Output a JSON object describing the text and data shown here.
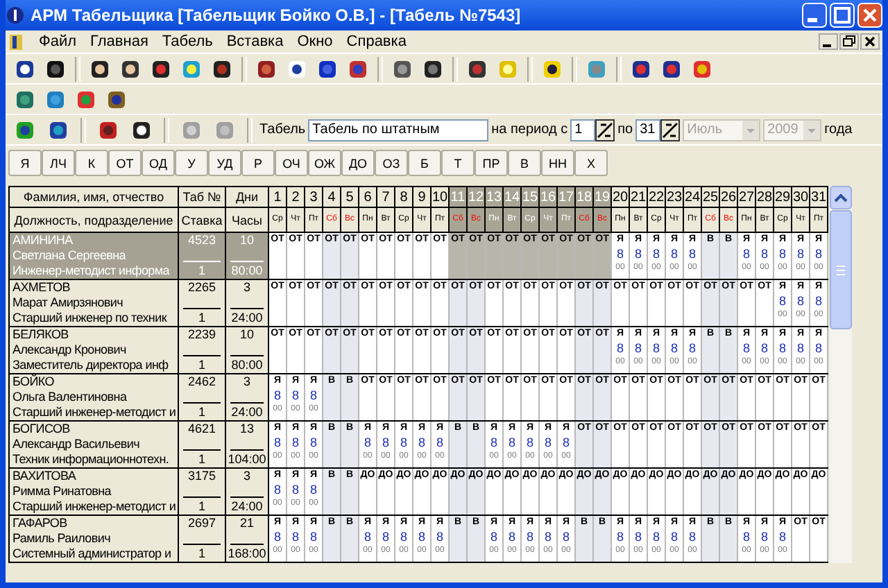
{
  "window": {
    "title": "АРМ Табельщика [Табельщик Бойко О.В.] - [Табель №7543]"
  },
  "menu": [
    "Файл",
    "Главная",
    "Табель",
    "Вставка",
    "Окно",
    "Справка"
  ],
  "form": {
    "label": "Табель",
    "value": "Табель по штатным",
    "period_label": "на период с",
    "from": "1",
    "to_label": "по",
    "to": "31",
    "month": {
      "value": "Июль",
      "disabled": true
    },
    "year": {
      "value": "2009",
      "disabled": true
    },
    "year_label": "года"
  },
  "code_buttons": [
    "Я",
    "ЛЧ",
    "К",
    "ОТ",
    "ОД",
    "У",
    "УД",
    "Р",
    "ОЧ",
    "ОЖ",
    "ДО",
    "ОЗ",
    "Б",
    "Т",
    "ПР",
    "В",
    "НН",
    "Х"
  ],
  "table": {
    "headers": {
      "name": "Фамилия, имя, отчество",
      "position": "Должность, подразделение",
      "tab": "Таб №",
      "rate": "Ставка",
      "days": "Дни",
      "hours": "Часы"
    },
    "days": [
      {
        "number": "1",
        "weekday": "Ср",
        "weekend": false,
        "selected": false
      },
      {
        "number": "2",
        "weekday": "Чт",
        "weekend": false,
        "selected": false
      },
      {
        "number": "3",
        "weekday": "Пт",
        "weekend": false,
        "selected": false
      },
      {
        "number": "4",
        "weekday": "Сб",
        "weekend": true,
        "selected": false
      },
      {
        "number": "5",
        "weekday": "Вс",
        "weekend": true,
        "selected": false
      },
      {
        "number": "6",
        "weekday": "Пн",
        "weekend": false,
        "selected": false
      },
      {
        "number": "7",
        "weekday": "Вт",
        "weekend": false,
        "selected": false
      },
      {
        "number": "8",
        "weekday": "Ср",
        "weekend": false,
        "selected": false
      },
      {
        "number": "9",
        "weekday": "Чт",
        "weekend": false,
        "selected": false
      },
      {
        "number": "10",
        "weekday": "Пт",
        "weekend": false,
        "selected": false
      },
      {
        "number": "11",
        "weekday": "Сб",
        "weekend": true,
        "selected": true
      },
      {
        "number": "12",
        "weekday": "Вс",
        "weekend": true,
        "selected": true
      },
      {
        "number": "13",
        "weekday": "Пн",
        "weekend": false,
        "selected": true
      },
      {
        "number": "14",
        "weekday": "Вт",
        "weekend": false,
        "selected": true
      },
      {
        "number": "15",
        "weekday": "Ср",
        "weekend": false,
        "selected": true
      },
      {
        "number": "16",
        "weekday": "Чт",
        "weekend": false,
        "selected": true
      },
      {
        "number": "17",
        "weekday": "Пт",
        "weekend": false,
        "selected": true
      },
      {
        "number": "18",
        "weekday": "Сб",
        "weekend": true,
        "selected": true
      },
      {
        "number": "19",
        "weekday": "Вс",
        "weekend": true,
        "selected": true
      },
      {
        "number": "20",
        "weekday": "Пн",
        "weekend": false,
        "selected": false
      },
      {
        "number": "21",
        "weekday": "Вт",
        "weekend": false,
        "selected": false
      },
      {
        "number": "22",
        "weekday": "Ср",
        "weekend": false,
        "selected": false
      },
      {
        "number": "23",
        "weekday": "Чт",
        "weekend": false,
        "selected": false
      },
      {
        "number": "24",
        "weekday": "Пт",
        "weekend": false,
        "selected": false
      },
      {
        "number": "25",
        "weekday": "Сб",
        "weekend": true,
        "selected": false
      },
      {
        "number": "26",
        "weekday": "Вс",
        "weekend": true,
        "selected": false
      },
      {
        "number": "27",
        "weekday": "Пн",
        "weekend": false,
        "selected": false
      },
      {
        "number": "28",
        "weekday": "Вт",
        "weekend": false,
        "selected": false
      },
      {
        "number": "29",
        "weekday": "Ср",
        "weekend": false,
        "selected": false
      },
      {
        "number": "30",
        "weekday": "Чт",
        "weekend": false,
        "selected": false
      },
      {
        "number": "31",
        "weekday": "Пт",
        "weekend": false,
        "selected": false
      }
    ],
    "rows": [
      {
        "surname": "АМИНИНА",
        "name": "Светлана Сергеевна",
        "position": "Инженер-методист информа",
        "tab": "4523",
        "rate": "1",
        "days": "10",
        "hours": "80:00",
        "selected": true,
        "cells": [
          {
            "code": "ОТ"
          },
          {
            "code": "ОТ"
          },
          {
            "code": "ОТ"
          },
          {
            "code": "ОТ"
          },
          {
            "code": "ОТ"
          },
          {
            "code": "ОТ"
          },
          {
            "code": "ОТ"
          },
          {
            "code": "ОТ"
          },
          {
            "code": "ОТ"
          },
          {
            "code": "ОТ"
          },
          {
            "code": "ОТ"
          },
          {
            "code": "ОТ"
          },
          {
            "code": "ОТ"
          },
          {
            "code": "ОТ"
          },
          {
            "code": "ОТ"
          },
          {
            "code": "ОТ"
          },
          {
            "code": "ОТ"
          },
          {
            "code": "ОТ"
          },
          {
            "code": "ОТ"
          },
          {
            "code": "Я",
            "hours": "8",
            "minutes": "00"
          },
          {
            "code": "Я",
            "hours": "8",
            "minutes": "00"
          },
          {
            "code": "Я",
            "hours": "8",
            "minutes": "00"
          },
          {
            "code": "Я",
            "hours": "8",
            "minutes": "00"
          },
          {
            "code": "Я",
            "hours": "8",
            "minutes": "00"
          },
          {
            "code": "В"
          },
          {
            "code": "В"
          },
          {
            "code": "Я",
            "hours": "8",
            "minutes": "00"
          },
          {
            "code": "Я",
            "hours": "8",
            "minutes": "00"
          },
          {
            "code": "Я",
            "hours": "8",
            "minutes": "00"
          },
          {
            "code": "Я",
            "hours": "8",
            "minutes": "00"
          },
          {
            "code": "Я",
            "hours": "8",
            "minutes": "00"
          }
        ]
      },
      {
        "surname": "АХМЕТОВ",
        "name": "Марат Амирзянович",
        "position": "Старший инженер по техник",
        "tab": "2265",
        "rate": "1",
        "days": "3",
        "hours": "24:00",
        "selected": false,
        "cells": [
          {
            "code": "ОТ"
          },
          {
            "code": "ОТ"
          },
          {
            "code": "ОТ"
          },
          {
            "code": "ОТ"
          },
          {
            "code": "ОТ"
          },
          {
            "code": "ОТ"
          },
          {
            "code": "ОТ"
          },
          {
            "code": "ОТ"
          },
          {
            "code": "ОТ"
          },
          {
            "code": "ОТ"
          },
          {
            "code": "ОТ"
          },
          {
            "code": "ОТ"
          },
          {
            "code": "ОТ"
          },
          {
            "code": "ОТ"
          },
          {
            "code": "ОТ"
          },
          {
            "code": "ОТ"
          },
          {
            "code": "ОТ"
          },
          {
            "code": "ОТ"
          },
          {
            "code": "ОТ"
          },
          {
            "code": "ОТ"
          },
          {
            "code": "ОТ"
          },
          {
            "code": "ОТ"
          },
          {
            "code": "ОТ"
          },
          {
            "code": "ОТ"
          },
          {
            "code": "ОТ"
          },
          {
            "code": "ОТ"
          },
          {
            "code": "ОТ"
          },
          {
            "code": "ОТ"
          },
          {
            "code": "Я",
            "hours": "8",
            "minutes": "00"
          },
          {
            "code": "Я",
            "hours": "8",
            "minutes": "00"
          },
          {
            "code": "Я",
            "hours": "8",
            "minutes": "00"
          }
        ]
      },
      {
        "surname": "БЕЛЯКОВ",
        "name": "Александр Кронович",
        "position": "Заместитель директора инф",
        "tab": "2239",
        "rate": "1",
        "days": "10",
        "hours": "80:00",
        "selected": false,
        "cells": [
          {
            "code": "ОТ"
          },
          {
            "code": "ОТ"
          },
          {
            "code": "ОТ"
          },
          {
            "code": "ОТ"
          },
          {
            "code": "ОТ"
          },
          {
            "code": "ОТ"
          },
          {
            "code": "ОТ"
          },
          {
            "code": "ОТ"
          },
          {
            "code": "ОТ"
          },
          {
            "code": "ОТ"
          },
          {
            "code": "ОТ"
          },
          {
            "code": "ОТ"
          },
          {
            "code": "ОТ"
          },
          {
            "code": "ОТ"
          },
          {
            "code": "ОТ"
          },
          {
            "code": "ОТ"
          },
          {
            "code": "ОТ"
          },
          {
            "code": "ОТ"
          },
          {
            "code": "ОТ"
          },
          {
            "code": "Я",
            "hours": "8",
            "minutes": "00"
          },
          {
            "code": "Я",
            "hours": "8",
            "minutes": "00"
          },
          {
            "code": "Я",
            "hours": "8",
            "minutes": "00"
          },
          {
            "code": "Я",
            "hours": "8",
            "minutes": "00"
          },
          {
            "code": "Я",
            "hours": "8",
            "minutes": "00"
          },
          {
            "code": "В"
          },
          {
            "code": "В"
          },
          {
            "code": "Я",
            "hours": "8",
            "minutes": "00"
          },
          {
            "code": "Я",
            "hours": "8",
            "minutes": "00"
          },
          {
            "code": "Я",
            "hours": "8",
            "minutes": "00"
          },
          {
            "code": "Я",
            "hours": "8",
            "minutes": "00"
          },
          {
            "code": "Я",
            "hours": "8",
            "minutes": "00"
          }
        ]
      },
      {
        "surname": "БОЙКО",
        "name": "Ольга Валентиновна",
        "position": "Старший инженер-методист и",
        "tab": "2462",
        "rate": "1",
        "days": "3",
        "hours": "24:00",
        "selected": false,
        "cells": [
          {
            "code": "Я",
            "hours": "8",
            "minutes": "00"
          },
          {
            "code": "Я",
            "hours": "8",
            "minutes": "00"
          },
          {
            "code": "Я",
            "hours": "8",
            "minutes": "00"
          },
          {
            "code": "В"
          },
          {
            "code": "В"
          },
          {
            "code": "ОТ"
          },
          {
            "code": "ОТ"
          },
          {
            "code": "ОТ"
          },
          {
            "code": "ОТ"
          },
          {
            "code": "ОТ"
          },
          {
            "code": "ОТ"
          },
          {
            "code": "ОТ"
          },
          {
            "code": "ОТ"
          },
          {
            "code": "ОТ"
          },
          {
            "code": "ОТ"
          },
          {
            "code": "ОТ"
          },
          {
            "code": "ОТ"
          },
          {
            "code": "ОТ"
          },
          {
            "code": "ОТ"
          },
          {
            "code": "ОТ"
          },
          {
            "code": "ОТ"
          },
          {
            "code": "ОТ"
          },
          {
            "code": "ОТ"
          },
          {
            "code": "ОТ"
          },
          {
            "code": "ОТ"
          },
          {
            "code": "ОТ"
          },
          {
            "code": "ОТ"
          },
          {
            "code": "ОТ"
          },
          {
            "code": "ОТ"
          },
          {
            "code": "ОТ"
          },
          {
            "code": "ОТ"
          }
        ]
      },
      {
        "surname": "БОГИСОВ",
        "name": "Александр Васильевич",
        "position": "Техник информационнотехн.",
        "tab": "4621",
        "rate": "1",
        "days": "13",
        "hours": "104:00",
        "selected": false,
        "cells": [
          {
            "code": "Я",
            "hours": "8",
            "minutes": "00"
          },
          {
            "code": "Я",
            "hours": "8",
            "minutes": "00"
          },
          {
            "code": "Я",
            "hours": "8",
            "minutes": "00"
          },
          {
            "code": "В"
          },
          {
            "code": "В"
          },
          {
            "code": "Я",
            "hours": "8",
            "minutes": "00"
          },
          {
            "code": "Я",
            "hours": "8",
            "minutes": "00"
          },
          {
            "code": "Я",
            "hours": "8",
            "minutes": "00"
          },
          {
            "code": "Я",
            "hours": "8",
            "minutes": "00"
          },
          {
            "code": "Я",
            "hours": "8",
            "minutes": "00"
          },
          {
            "code": "В"
          },
          {
            "code": "В"
          },
          {
            "code": "Я",
            "hours": "8",
            "minutes": "00"
          },
          {
            "code": "Я",
            "hours": "8",
            "minutes": "00"
          },
          {
            "code": "Я",
            "hours": "8",
            "minutes": "00"
          },
          {
            "code": "Я",
            "hours": "8",
            "minutes": "00"
          },
          {
            "code": "Я",
            "hours": "8",
            "minutes": "00"
          },
          {
            "code": "ОТ"
          },
          {
            "code": "ОТ"
          },
          {
            "code": "ОТ"
          },
          {
            "code": "ОТ"
          },
          {
            "code": "ОТ"
          },
          {
            "code": "ОТ"
          },
          {
            "code": "ОТ"
          },
          {
            "code": "ОТ"
          },
          {
            "code": "ОТ"
          },
          {
            "code": "ОТ"
          },
          {
            "code": "ОТ"
          },
          {
            "code": "ОТ"
          },
          {
            "code": "ОТ"
          },
          {
            "code": "ОТ"
          }
        ]
      },
      {
        "surname": "ВАХИТОВА",
        "name": "Римма Ринатовна",
        "position": "Старший инженер-методист и",
        "tab": "3175",
        "rate": "1",
        "days": "3",
        "hours": "24:00",
        "selected": false,
        "cells": [
          {
            "code": "Я",
            "hours": "8",
            "minutes": "00"
          },
          {
            "code": "Я",
            "hours": "8",
            "minutes": "00"
          },
          {
            "code": "Я",
            "hours": "8",
            "minutes": "00"
          },
          {
            "code": "В"
          },
          {
            "code": "В"
          },
          {
            "code": "ДО"
          },
          {
            "code": "ДО"
          },
          {
            "code": "ДО"
          },
          {
            "code": "ДО"
          },
          {
            "code": "ДО"
          },
          {
            "code": "ДО"
          },
          {
            "code": "ДО"
          },
          {
            "code": "ДО"
          },
          {
            "code": "ДО"
          },
          {
            "code": "ДО"
          },
          {
            "code": "ДО"
          },
          {
            "code": "ДО"
          },
          {
            "code": "ДО"
          },
          {
            "code": "ДО"
          },
          {
            "code": "ДО"
          },
          {
            "code": "ДО"
          },
          {
            "code": "ДО"
          },
          {
            "code": "ДО"
          },
          {
            "code": "ДО"
          },
          {
            "code": "ДО"
          },
          {
            "code": "ДО"
          },
          {
            "code": "ДО"
          },
          {
            "code": "ДО"
          },
          {
            "code": "ДО"
          },
          {
            "code": "ДО"
          },
          {
            "code": "ДО"
          }
        ]
      },
      {
        "surname": "ГАФАРОВ",
        "name": "Рамиль Раилович",
        "position": "Системный администратор и",
        "tab": "2697",
        "rate": "1",
        "days": "21",
        "hours": "168:00",
        "selected": false,
        "cells": [
          {
            "code": "Я",
            "hours": "8",
            "minutes": "00"
          },
          {
            "code": "Я",
            "hours": "8",
            "minutes": "00"
          },
          {
            "code": "Я",
            "hours": "8",
            "minutes": "00"
          },
          {
            "code": "В"
          },
          {
            "code": "В"
          },
          {
            "code": "Я",
            "hours": "8",
            "minutes": "00"
          },
          {
            "code": "Я",
            "hours": "8",
            "minutes": "00"
          },
          {
            "code": "Я",
            "hours": "8",
            "minutes": "00"
          },
          {
            "code": "Я",
            "hours": "8",
            "minutes": "00"
          },
          {
            "code": "Я",
            "hours": "8",
            "minutes": "00"
          },
          {
            "code": "В"
          },
          {
            "code": "В"
          },
          {
            "code": "Я",
            "hours": "8",
            "minutes": "00"
          },
          {
            "code": "Я",
            "hours": "8",
            "minutes": "00"
          },
          {
            "code": "Я",
            "hours": "8",
            "minutes": "00"
          },
          {
            "code": "Я",
            "hours": "8",
            "minutes": "00"
          },
          {
            "code": "Я",
            "hours": "8",
            "minutes": "00"
          },
          {
            "code": "В"
          },
          {
            "code": "В"
          },
          {
            "code": "Я",
            "hours": "8",
            "minutes": "00"
          },
          {
            "code": "Я",
            "hours": "8",
            "minutes": "00"
          },
          {
            "code": "Я",
            "hours": "8",
            "minutes": "00"
          },
          {
            "code": "Я",
            "hours": "8",
            "minutes": "00"
          },
          {
            "code": "Я",
            "hours": "8",
            "minutes": "00"
          },
          {
            "code": "В"
          },
          {
            "code": "В"
          },
          {
            "code": "Я",
            "hours": "8",
            "minutes": "00"
          },
          {
            "code": "Я",
            "hours": "8",
            "minutes": "00"
          },
          {
            "code": "Я",
            "hours": "8",
            "minutes": "00"
          },
          {
            "code": "ОТ"
          },
          {
            "code": "ОТ"
          }
        ]
      }
    ]
  }
}
